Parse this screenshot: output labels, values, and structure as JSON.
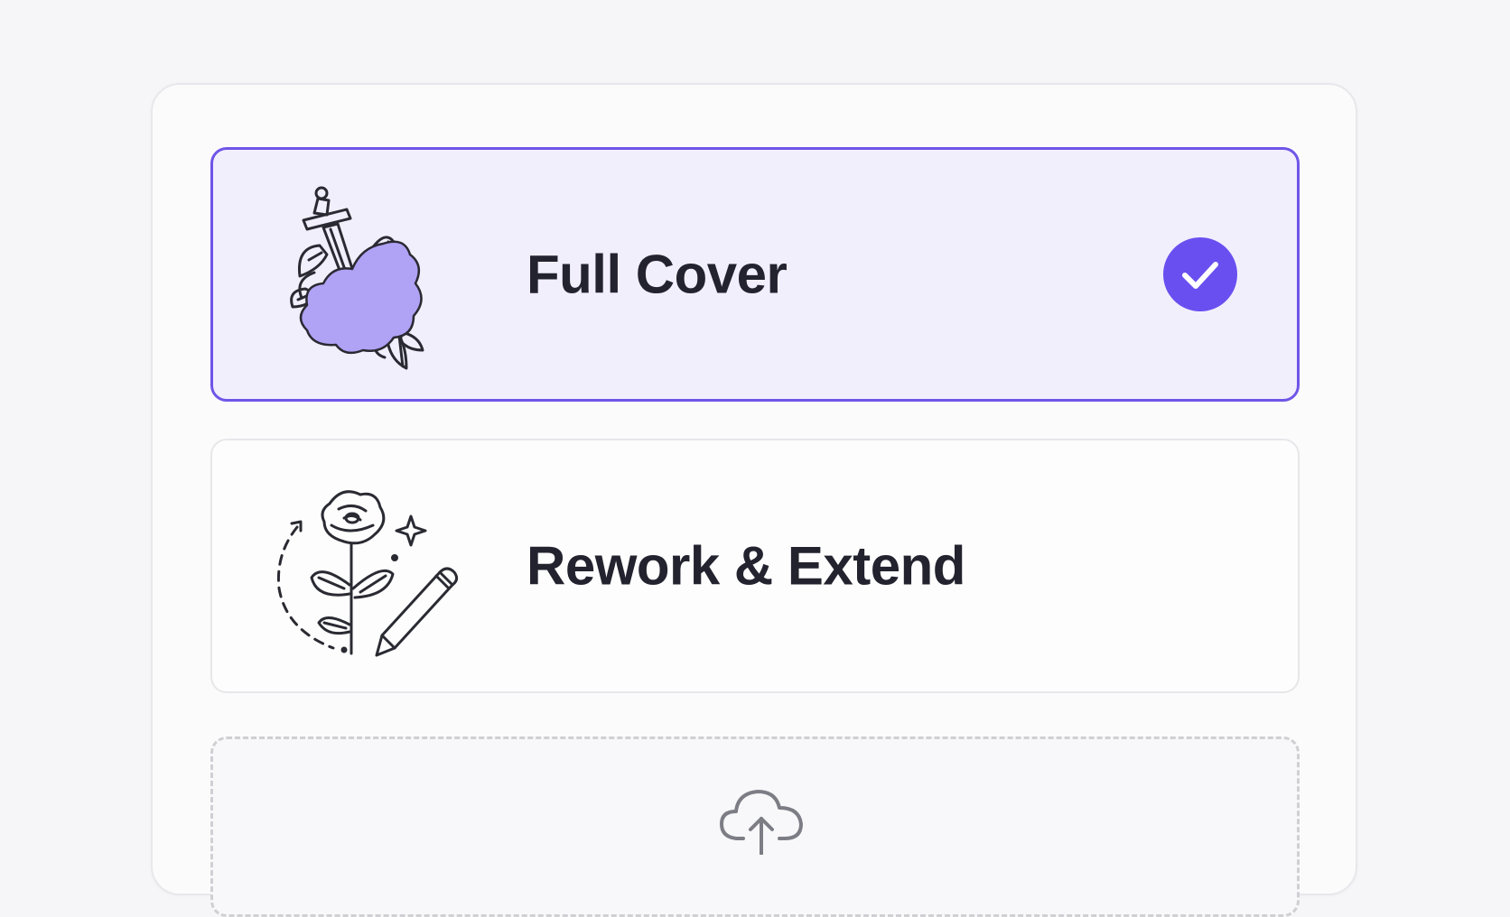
{
  "options": [
    {
      "label": "Full Cover",
      "selected": true,
      "icon": "dagger-rose-covered-icon"
    },
    {
      "label": "Rework & Extend",
      "selected": false,
      "icon": "rose-pencil-rework-icon"
    }
  ],
  "upload": {
    "icon": "cloud-upload-icon"
  },
  "colors": {
    "accent": "#6a4ff0",
    "selected_bg": "#f2effd",
    "selected_border": "#6f55e8",
    "blob": "#b0a2f5",
    "text": "#23232f"
  }
}
